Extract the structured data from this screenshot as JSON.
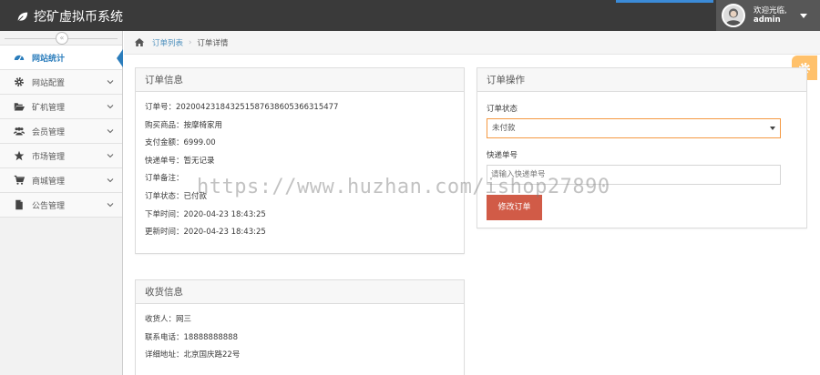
{
  "app": {
    "title": "挖矿虚拟币系统"
  },
  "user": {
    "greeting": "欢迎光临,",
    "name": "admin"
  },
  "sidebar": {
    "collapse_icon": "«",
    "items": [
      {
        "label": "网站统计",
        "icon": "dashboard-icon",
        "active": true
      },
      {
        "label": "网站配置",
        "icon": "gear-icon"
      },
      {
        "label": "矿机管理",
        "icon": "folder-open-icon"
      },
      {
        "label": "会员管理",
        "icon": "users-icon"
      },
      {
        "label": "市场管理",
        "icon": "star-icon"
      },
      {
        "label": "商城管理",
        "icon": "cart-icon"
      },
      {
        "label": "公告管理",
        "icon": "file-icon"
      }
    ]
  },
  "breadcrumb": {
    "parent": "订单列表",
    "current": "订单详情"
  },
  "order_info": {
    "title": "订单信息",
    "rows": [
      "订单号：202004231843251587638605366315477",
      "购买商品：按摩椅家用",
      "支付金额：6999.00",
      "快递单号：暂无记录",
      "订单备注：",
      "订单状态：已付款",
      "下单时间：2020-04-23 18:43:25",
      "更新时间：2020-04-23 18:43:25"
    ]
  },
  "order_ops": {
    "title": "订单操作",
    "status_label": "订单状态",
    "status_value": "未付款",
    "tracking_label": "快递单号",
    "tracking_placeholder": "请输入快递单号",
    "submit_label": "修改订单"
  },
  "shipping": {
    "title": "收货信息",
    "rows": [
      "收货人：网三",
      "联系电话：18888888888",
      "详细地址：北京国庆路22号"
    ]
  },
  "watermark": "https://www.huzhan.com/ishop27890",
  "colors": {
    "navbar": "#3a3a3a",
    "accent": "#2b7dbc",
    "danger": "#d15b47",
    "warning": "#ffb752"
  }
}
